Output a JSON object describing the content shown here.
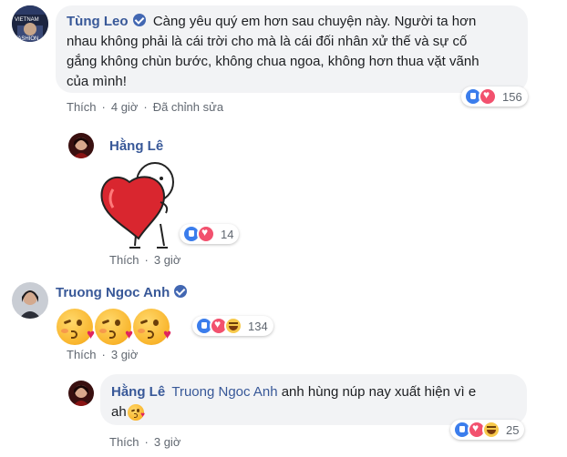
{
  "comments": [
    {
      "author": "Tùng Leo",
      "verified": true,
      "text_lines": [
        "Càng yêu quý em hơn sau chuyện này. Người ta hơn",
        "nhau không phải là cái trời cho mà là cái đối nhân xử thế và sự cố",
        "gắng không chùn bước, không chua ngoa, không hơn thua vặt vãnh",
        "của mình!"
      ],
      "like_label": "Thích",
      "time": "4 giờ",
      "edited_label": "Đã chỉnh sửa",
      "reactions": [
        "like",
        "love"
      ],
      "reaction_count": "156"
    },
    {
      "author": "Hằng Lê",
      "verified": false,
      "sticker": "heart-hug-sticker",
      "like_label": "Thích",
      "time": "3 giờ",
      "reactions": [
        "like",
        "love"
      ],
      "reaction_count": "14"
    },
    {
      "author": "Truong Ngoc Anh",
      "verified": true,
      "emojis": [
        "kissing-heart-emoji",
        "kissing-heart-emoji",
        "kissing-heart-emoji"
      ],
      "like_label": "Thích",
      "time": "3 giờ",
      "reactions": [
        "like",
        "love",
        "haha"
      ],
      "reaction_count": "134"
    },
    {
      "author": "Hằng Lê",
      "verified": false,
      "mention": "Truong Ngoc Anh",
      "text_line1": "anh hùng núp nay xuất hiện vì e",
      "text_line2": "ah",
      "like_label": "Thích",
      "time": "3 giờ",
      "reactions": [
        "like",
        "love",
        "haha"
      ],
      "reaction_count": "25"
    }
  ],
  "avatar_texts": {
    "tung_leo": [
      "VIETNAM",
      "FASHION"
    ]
  },
  "colors": {
    "name": "#385898",
    "bubble": "#f2f3f5",
    "meta": "#606770",
    "like": "#3b7dec",
    "love": "#f2516e",
    "haha": "#f7c94b",
    "verified": "#4267b2"
  }
}
